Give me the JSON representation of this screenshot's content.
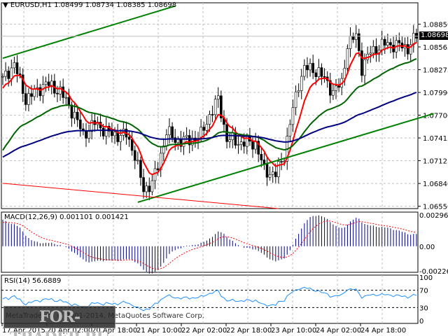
{
  "header": {
    "symbol": "EURUSD,H1",
    "open": "1.08499",
    "high": "1.08734",
    "low": "1.08385",
    "close": "1.08698"
  },
  "current_price": "1.08698",
  "macd": {
    "label": "MACD(12,26,9)",
    "value": "0.001101",
    "signal": "0.001421",
    "ticks": [
      "0.002969",
      "0.00",
      "-0.002264"
    ]
  },
  "rsi": {
    "label": "RSI(14)",
    "value": "56.6889",
    "ticks": [
      "100",
      "70",
      "30",
      "0"
    ]
  },
  "copyright": "MetaTrader 4, © 2001-2014, MetaQuotes Software Corp.",
  "watermark": "FOR-TRADER.RU",
  "colors": {
    "bull": "#000000",
    "bear": "#000000",
    "ma_fast": "#ff0000",
    "ma_mid": "#006400",
    "ma_slow": "#000080",
    "trend": "#008000",
    "trend_red": "#ff0000",
    "macd_hist": "#000080",
    "macd_signal": "#ff0000",
    "rsi": "#1e90ff"
  },
  "chart_data": {
    "type": "candlestick",
    "title": "EURUSD,H1",
    "bars": 145,
    "x_tick_labels": [
      "17 Apr 2015",
      "20 Apr 02:00",
      "20 Apr 18:00",
      "21 Apr 10:00",
      "22 Apr 02:00",
      "22 Apr 18:00",
      "23 Apr 10:00",
      "24 Apr 02:00",
      "24 Apr 18:00"
    ],
    "y_tick_labels": [
      "1.08850",
      "1.08565",
      "1.08275",
      "1.07990",
      "1.07700",
      "1.07415",
      "1.07125",
      "1.06840",
      "1.06550"
    ],
    "ylim": [
      1.0652,
      1.0912
    ],
    "close_path": [
      [
        0,
        1.0815
      ],
      [
        4,
        1.0835
      ],
      [
        8,
        1.079
      ],
      [
        15,
        1.081
      ],
      [
        20,
        1.08
      ],
      [
        25,
        1.077
      ],
      [
        28,
        1.0745
      ],
      [
        32,
        1.076
      ],
      [
        38,
        1.0745
      ],
      [
        43,
        1.0745
      ],
      [
        46,
        1.072
      ],
      [
        49,
        1.0675
      ],
      [
        52,
        1.0685
      ],
      [
        54,
        1.0705
      ],
      [
        57,
        1.075
      ],
      [
        60,
        1.0738
      ],
      [
        65,
        1.0738
      ],
      [
        69,
        1.0745
      ],
      [
        72,
        1.077
      ],
      [
        75,
        1.079
      ],
      [
        78,
        1.074
      ],
      [
        83,
        1.0735
      ],
      [
        88,
        1.0735
      ],
      [
        91,
        1.07
      ],
      [
        95,
        1.0695
      ],
      [
        98,
        1.072
      ],
      [
        100,
        1.076
      ],
      [
        103,
        1.081
      ],
      [
        105,
        1.083
      ],
      [
        110,
        1.0825
      ],
      [
        115,
        1.08
      ],
      [
        118,
        1.081
      ],
      [
        120,
        1.086
      ],
      [
        123,
        1.087
      ],
      [
        125,
        1.083
      ],
      [
        128,
        1.085
      ],
      [
        133,
        1.086
      ],
      [
        138,
        1.0858
      ],
      [
        141,
        1.0855
      ],
      [
        144,
        1.087
      ]
    ],
    "moving_averages": [
      {
        "name": "fast",
        "period": 8,
        "seed": 1.08
      },
      {
        "name": "mid",
        "period": 34,
        "seed": 1.072
      },
      {
        "name": "slow",
        "period": 100,
        "seed": 1.0715
      }
    ],
    "trendlines": [
      {
        "color": "trend",
        "from": [
          0,
          1.0842
        ],
        "to": [
          60,
          1.0908
        ]
      },
      {
        "color": "trend",
        "from": [
          47,
          1.066
        ],
        "to": [
          150,
          1.0772
        ]
      },
      {
        "color": "trend_red",
        "from": [
          0,
          1.0684
        ],
        "to": [
          96,
          1.0652
        ]
      }
    ],
    "macd_ylim": [
      -0.002264,
      0.002969
    ],
    "rsi_ylim": [
      0,
      100
    ],
    "rsi_levels": [
      70,
      30
    ]
  }
}
